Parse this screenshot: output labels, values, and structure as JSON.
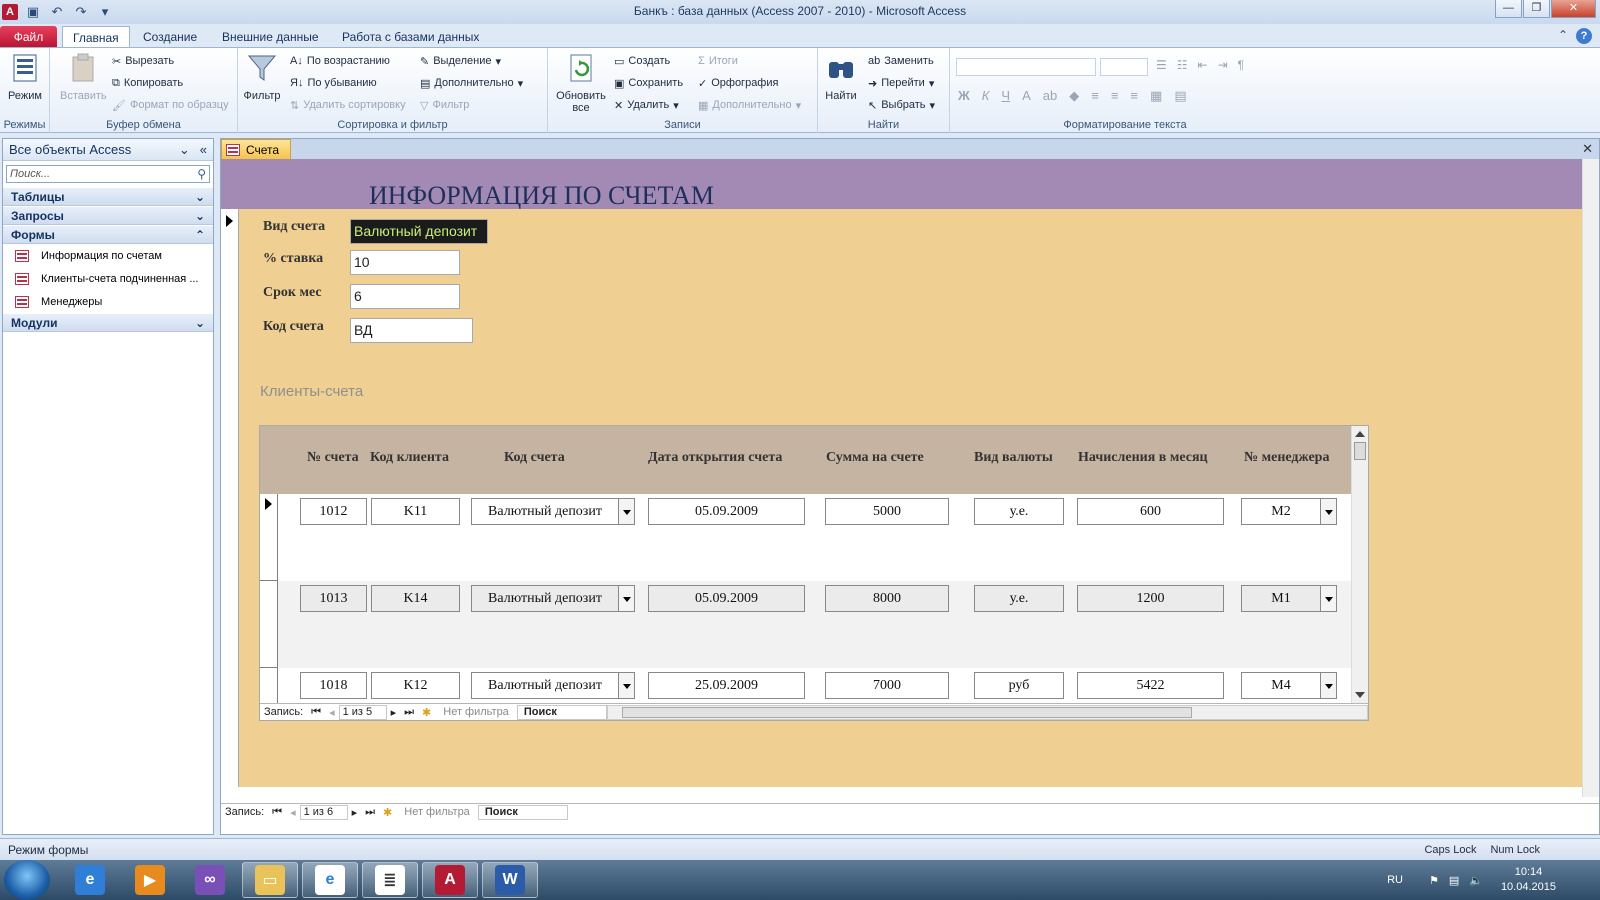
{
  "window": {
    "title": "Банкъ : база данных (Access 2007 - 2010)  -  Microsoft Access",
    "app_icon": "A",
    "controls": {
      "minimize": "—",
      "restore": "❐",
      "close": "✕"
    }
  },
  "ribbon_tabs": {
    "file": "Файл",
    "tabs": [
      "Главная",
      "Создание",
      "Внешние данные",
      "Работа с базами данных"
    ],
    "active_index": 0
  },
  "ribbon": {
    "views": {
      "mode": "Режим",
      "group": "Режимы"
    },
    "clipboard": {
      "paste": "Вставить",
      "cut": "Вырезать",
      "copy": "Копировать",
      "format_painter": "Формат по образцу",
      "group": "Буфер обмена"
    },
    "sort_filter": {
      "filter": "Фильтр",
      "ascending": "По возрастанию",
      "descending": "По убыванию",
      "remove_sort": "Удалить сортировку",
      "selection": "Выделение",
      "advanced": "Дополнительно",
      "toggle_filter": "Фильтр",
      "group": "Сортировка и фильтр"
    },
    "records": {
      "refresh_all": "Обновить все",
      "new": "Создать",
      "save": "Сохранить",
      "delete": "Удалить",
      "totals": "Итоги",
      "spelling": "Орфография",
      "more": "Дополнительно",
      "group": "Записи"
    },
    "find": {
      "find": "Найти",
      "replace": "Заменить",
      "goto": "Перейти",
      "select": "Выбрать",
      "group": "Найти"
    },
    "text_format": {
      "group": "Форматирование текста"
    }
  },
  "nav_pane": {
    "title": "Все объекты Access",
    "search_placeholder": "Поиск...",
    "categories": [
      {
        "label": "Таблицы",
        "items": []
      },
      {
        "label": "Запросы",
        "items": []
      },
      {
        "label": "Формы",
        "items": [
          "Информация по счетам",
          "Клиенты-счета подчиненная ...",
          "Менеджеры"
        ]
      },
      {
        "label": "Модули",
        "items": []
      }
    ]
  },
  "document": {
    "tab_label": "Счета",
    "form_title": "ИНФОРМАЦИЯ ПО СЧЕТАМ",
    "fields": [
      {
        "label": "Вид счета",
        "value": "Валютный депозит"
      },
      {
        "label": "% ставка",
        "value": "10"
      },
      {
        "label": "Срок мес",
        "value": "6"
      },
      {
        "label": "Код счета",
        "value": "ВД"
      }
    ],
    "subform": {
      "label": "Клиенты-счета",
      "columns": [
        "№ счета",
        "Код клиента",
        "Код счета",
        "Дата открытия счета",
        "Сумма на счете",
        "Вид валюты",
        "Начисления в месяц",
        "№ менеджера"
      ],
      "rows": [
        [
          "1012",
          "K11",
          "Валютный депозит",
          "05.09.2009",
          "5000",
          "у.е.",
          "600",
          "M2"
        ],
        [
          "1013",
          "K14",
          "Валютный депозит",
          "05.09.2009",
          "8000",
          "у.е.",
          "1200",
          "M1"
        ],
        [
          "1018",
          "K12",
          "Валютный депозит",
          "25.09.2009",
          "7000",
          "руб",
          "5422",
          "M4"
        ]
      ],
      "navigator": {
        "label": "Запись:",
        "position": "1 из 5",
        "filter": "Нет фильтра",
        "search": "Поиск"
      }
    },
    "navigator": {
      "label": "Запись:",
      "position": "1 из 6",
      "filter": "Нет фильтра",
      "search": "Поиск"
    }
  },
  "statusbar": {
    "mode": "Режим формы",
    "caps": "Caps Lock",
    "num": "Num Lock"
  },
  "taskbar": {
    "lang": "RU",
    "time": "10:14",
    "date": "10.04.2015",
    "apps": [
      "internet-explorer",
      "media-player",
      "visual-studio",
      "explorer",
      "ie-document",
      "notepad",
      "access",
      "word"
    ]
  }
}
